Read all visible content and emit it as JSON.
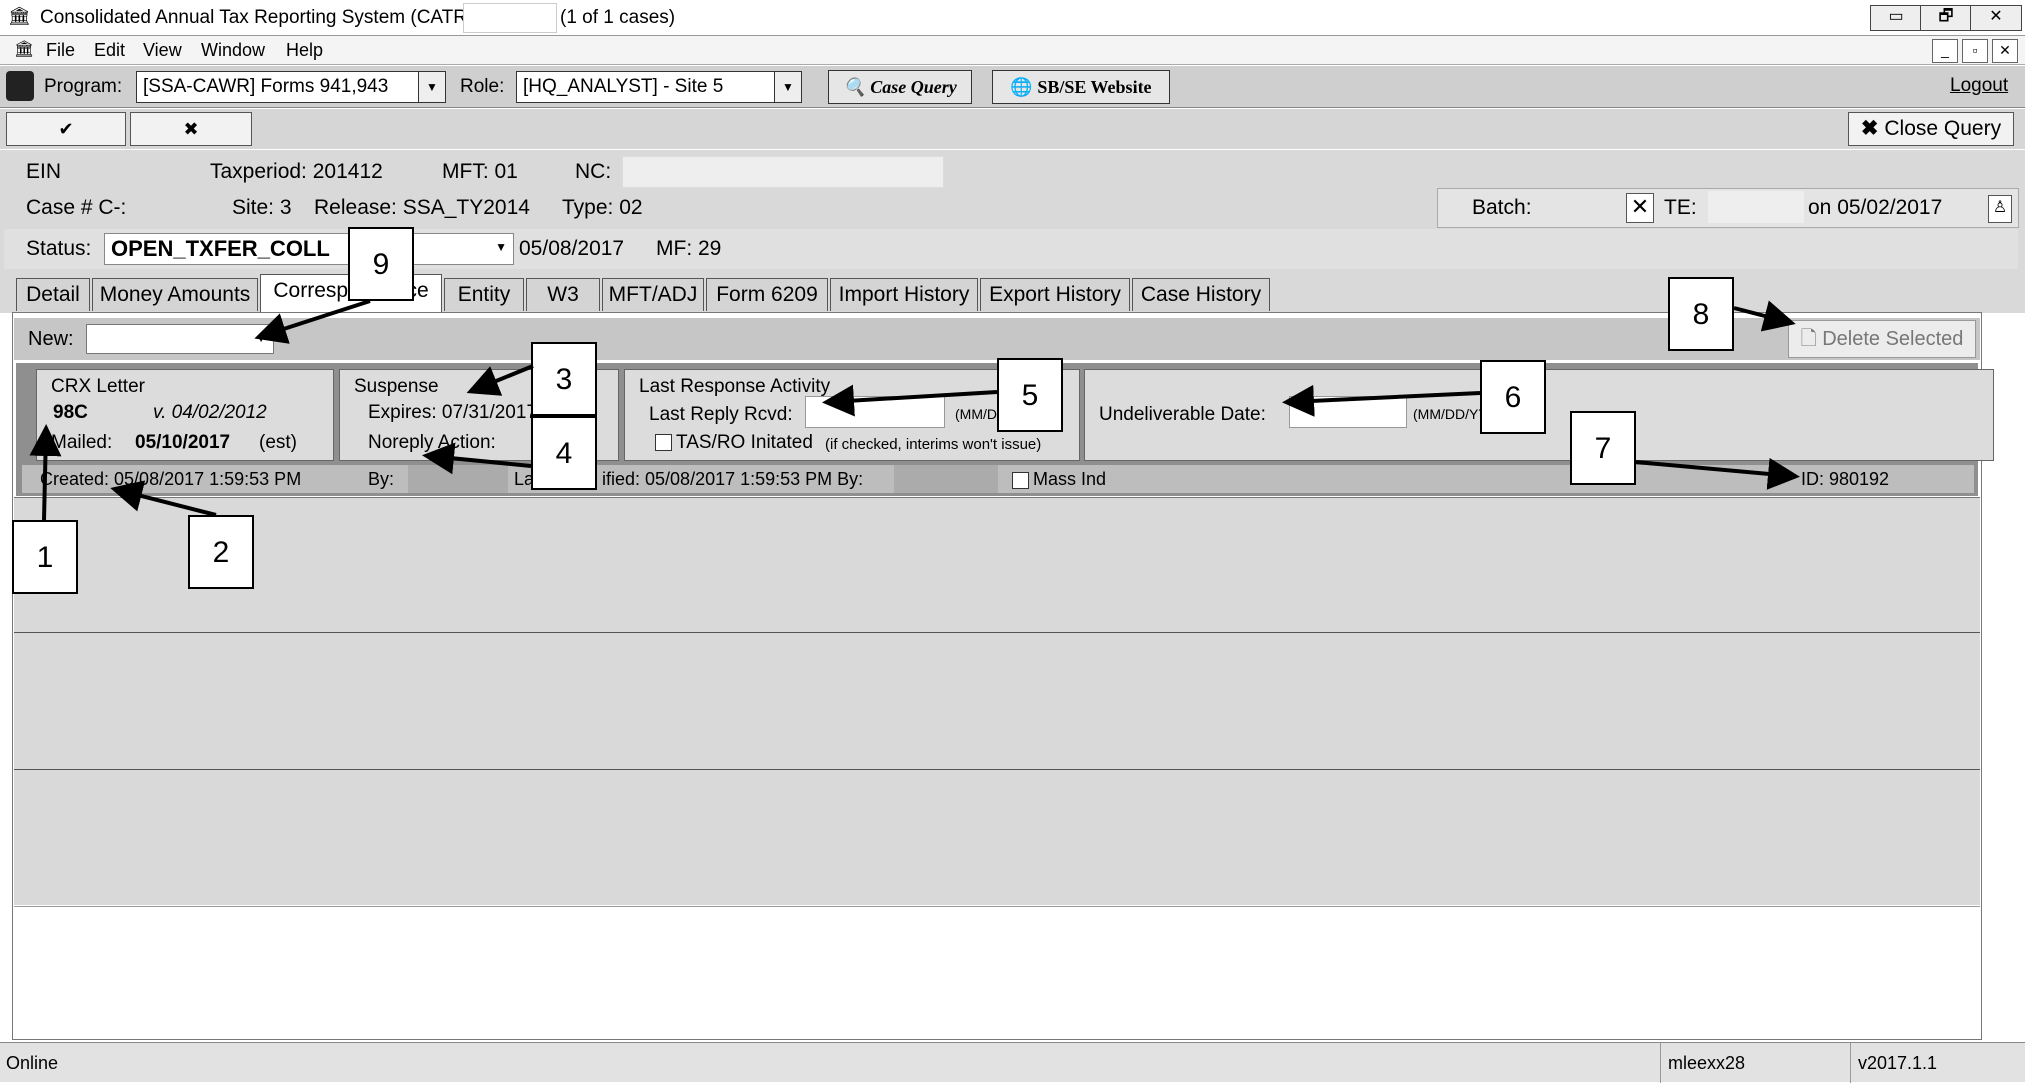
{
  "window": {
    "title": "Consolidated Annual Tax Reporting System (CATRS) -",
    "case_count": "(1 of 1 cases)",
    "minimize": "▭",
    "restore": "🗗",
    "close": "✕"
  },
  "menu": {
    "items": [
      "File",
      "Edit",
      "View",
      "Window",
      "Help"
    ]
  },
  "toolbar": {
    "program_label": "Program:",
    "program_value": "[SSA-CAWR] Forms 941,943",
    "role_label": "Role:",
    "role_value": "[HQ_ANALYST] - Site 5",
    "case_query": "Case Query",
    "website": "SB/SE Website",
    "logout": "Logout"
  },
  "actions": {
    "accept": "✔",
    "cancel": "✖",
    "close_query": "Close Query"
  },
  "header": {
    "ein_label": "EIN",
    "taxperiod": "Taxperiod: 201412",
    "mft": "MFT: 01",
    "nc": "NC:",
    "case": "Case # C-:",
    "site": "Site: 3",
    "release": "Release: SSA_TY2014",
    "type": "Type: 02",
    "batch": "Batch:",
    "te": "TE:",
    "on_date": "on 05/02/2017",
    "status_label": "Status:",
    "status_value": "OPEN_TXFER_COLL",
    "status_date": "05/08/2017",
    "mf": "MF: 29"
  },
  "tabs": [
    "Detail",
    "Money Amounts",
    "Correspondence",
    "Entity",
    "W3",
    "MFT/ADJ",
    "Form 6209",
    "Import History",
    "Export History",
    "Case History"
  ],
  "correspondence": {
    "new_label": "New:",
    "delete_selected": "Delete Selected",
    "crx_title": "CRX Letter",
    "letter": "98C",
    "letter_version": "v. 04/02/2012",
    "mailed_label": "Mailed:",
    "mailed_date": "05/10/2017",
    "mailed_est": "(est)",
    "suspense_title": "Suspense",
    "expires": "Expires:  07/31/2017",
    "noreply": "Noreply Action:",
    "lra_title": "Last Response Activity",
    "last_reply": "Last Reply Rcvd:",
    "date_fmt": "(MM/DD/YY)",
    "date_fmt_cut": "(MM/DD/Y",
    "tas_label": "TAS/RO Initated",
    "tas_note": "(if checked, interims won't issue)",
    "undeliverable": "Undeliverable Date:",
    "created": "Created:  05/08/2017 1:59:53 PM",
    "by": "By:",
    "modified_a": "La",
    "modified_b": "ified:  05/08/2017 1:59:53 PM  By:",
    "mass_ind": "Mass Ind",
    "id": "ID:  980192"
  },
  "callouts": [
    "1",
    "2",
    "3",
    "4",
    "5",
    "6",
    "7",
    "8",
    "9"
  ],
  "status": {
    "left": "Online",
    "user": "mleexx28",
    "version": "v2017.1.1"
  }
}
